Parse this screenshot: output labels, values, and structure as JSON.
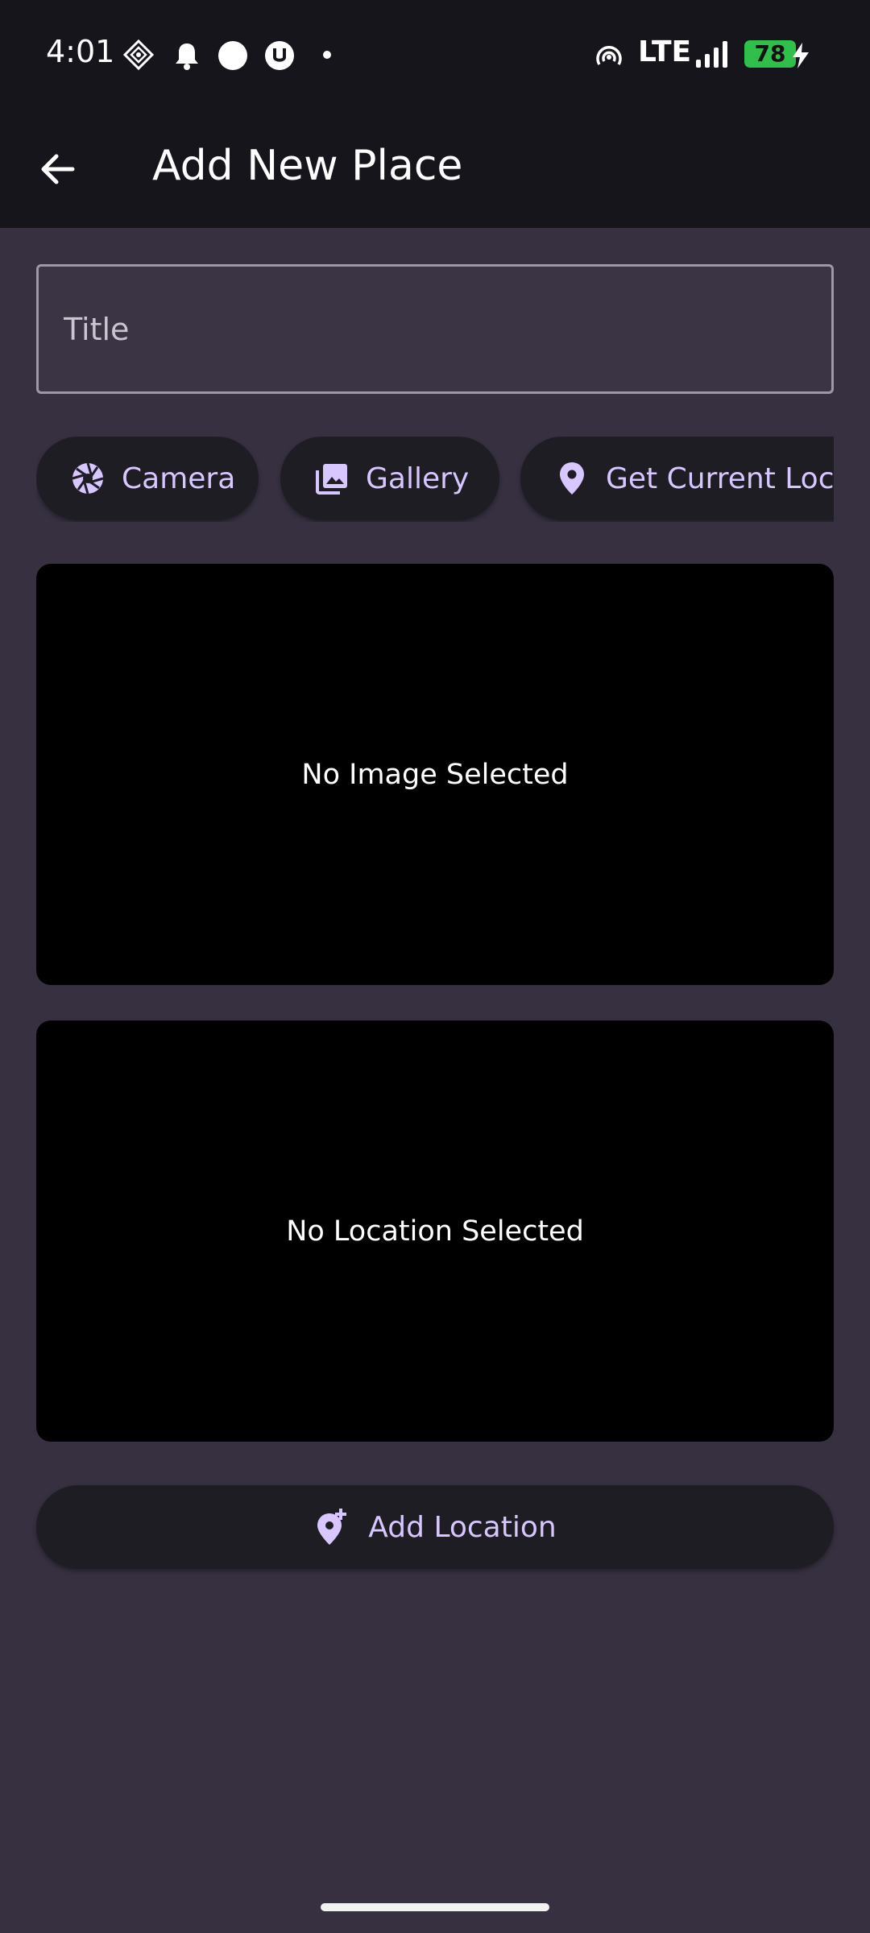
{
  "status_bar": {
    "time": "4:01",
    "network": "LTE",
    "battery": "78",
    "icons": [
      "vpn-diamond-icon",
      "notification-bell-icon",
      "circle-dot-icon",
      "u-badge-icon",
      "small-dot-icon",
      "hotspot-icon",
      "signal-bars-icon",
      "battery-icon",
      "charging-bolt-icon"
    ]
  },
  "app_bar": {
    "title": "Add New Place",
    "back_icon": "arrow-left-icon"
  },
  "form": {
    "title_placeholder": "Title",
    "title_value": ""
  },
  "actions": {
    "camera_label": "Camera",
    "gallery_label": "Gallery",
    "location_label": "Get Current Location"
  },
  "previews": {
    "image_empty": "No Image Selected",
    "location_empty": "No Location Selected"
  },
  "add_location": {
    "label": "Add Location"
  },
  "colors": {
    "background": "#363041",
    "bar": "#17151c",
    "chip": "#1f1d24",
    "accent": "#d8c6ff",
    "battery": "#2fbf4a"
  }
}
